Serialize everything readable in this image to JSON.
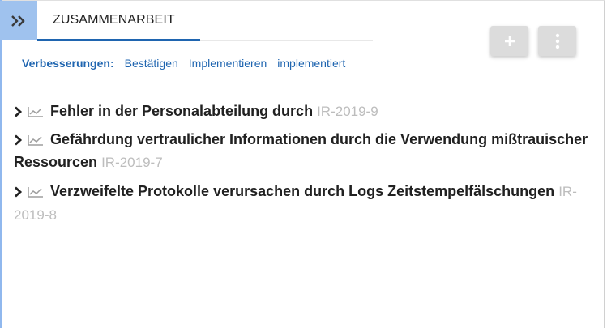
{
  "tab": {
    "label": "ZUSAMMENARBEIT"
  },
  "toolbar": {
    "add_icon": "plus-icon",
    "more_icon": "more-vertical-icon",
    "expand_icon": "double-chevron-right-icon"
  },
  "filters": {
    "label": "Verbesserungen:",
    "links": [
      "Bestätigen",
      "Implementieren",
      "implementiert"
    ]
  },
  "items": [
    {
      "title": "Fehler in der Personalabteilung durch",
      "id": "IR-2019-9"
    },
    {
      "title": "Gefährdung vertraulicher Informationen durch die Verwendung mißtrauischer Ressourcen",
      "id": "IR-2019-7"
    },
    {
      "title": "Verzweifelte Protokolle verursachen durch Logs Zeitstempelfälschungen",
      "id": "IR-2019-8"
    }
  ],
  "colors": {
    "accent": "#1f65b0",
    "expand_bg": "#9fc2ee",
    "muted": "#bdbdbd"
  }
}
